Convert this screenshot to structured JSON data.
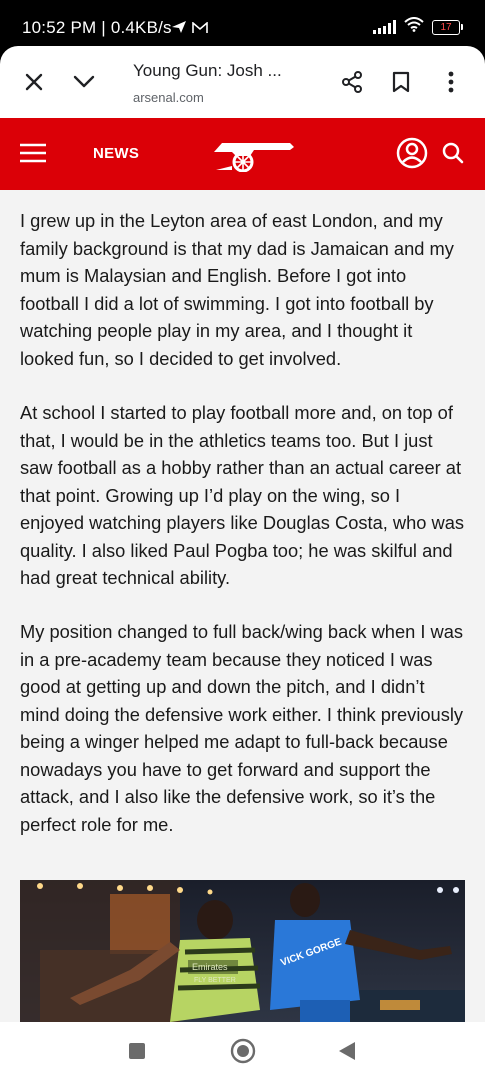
{
  "status_bar": {
    "left_text": "10:52 PM | 0.4KB/s",
    "battery": "17"
  },
  "browser": {
    "title": "Young Gun: Josh ...",
    "url": "arsenal.com"
  },
  "site_header": {
    "section": "NEWS"
  },
  "article": {
    "paragraphs": [
      "I grew up in the Leyton area of east London, and my family background is that my dad is Jamaican and my mum is Malaysian and English. Before I got into football I did a lot of swimming. I got into football by watching people play in my area, and I thought it looked fun, so I decided to get involved.",
      "At school I started to play football more and, on top of that, I would be in the athletics teams too. But I just saw football as a hobby rather than an actual career at that point. Growing up I’d play on the wing, so I enjoyed watching players like Douglas Costa, who was quality. I also liked Paul Pogba too; he was skilful and had great technical ability.",
      "My position changed to full back/wing back when I was in a pre-academy team because they noticed I was good at getting up and down the pitch, and I didn’t mind doing the defensive work either. I think previously being a winger helped me adapt to full-back because nowadays you have to get forward and support the attack, and I also like the defensive work, so it’s the perfect role for me."
    ],
    "photo_shirt_texts": [
      "Emirates",
      "FLY BETTER",
      "VICK GORGE"
    ]
  },
  "icons": {
    "close": "close-icon",
    "chevron": "chevron-down-icon",
    "share": "share-icon",
    "bookmark": "bookmark-icon",
    "menu": "more-vert-icon",
    "hamburger": "hamburger-menu-icon",
    "logo": "cannon-logo-icon",
    "account": "account-icon",
    "search": "search-icon"
  },
  "colors": {
    "brand_red": "#db0007",
    "page_bg": "#f3f3f3",
    "text": "#1a1a1a"
  }
}
